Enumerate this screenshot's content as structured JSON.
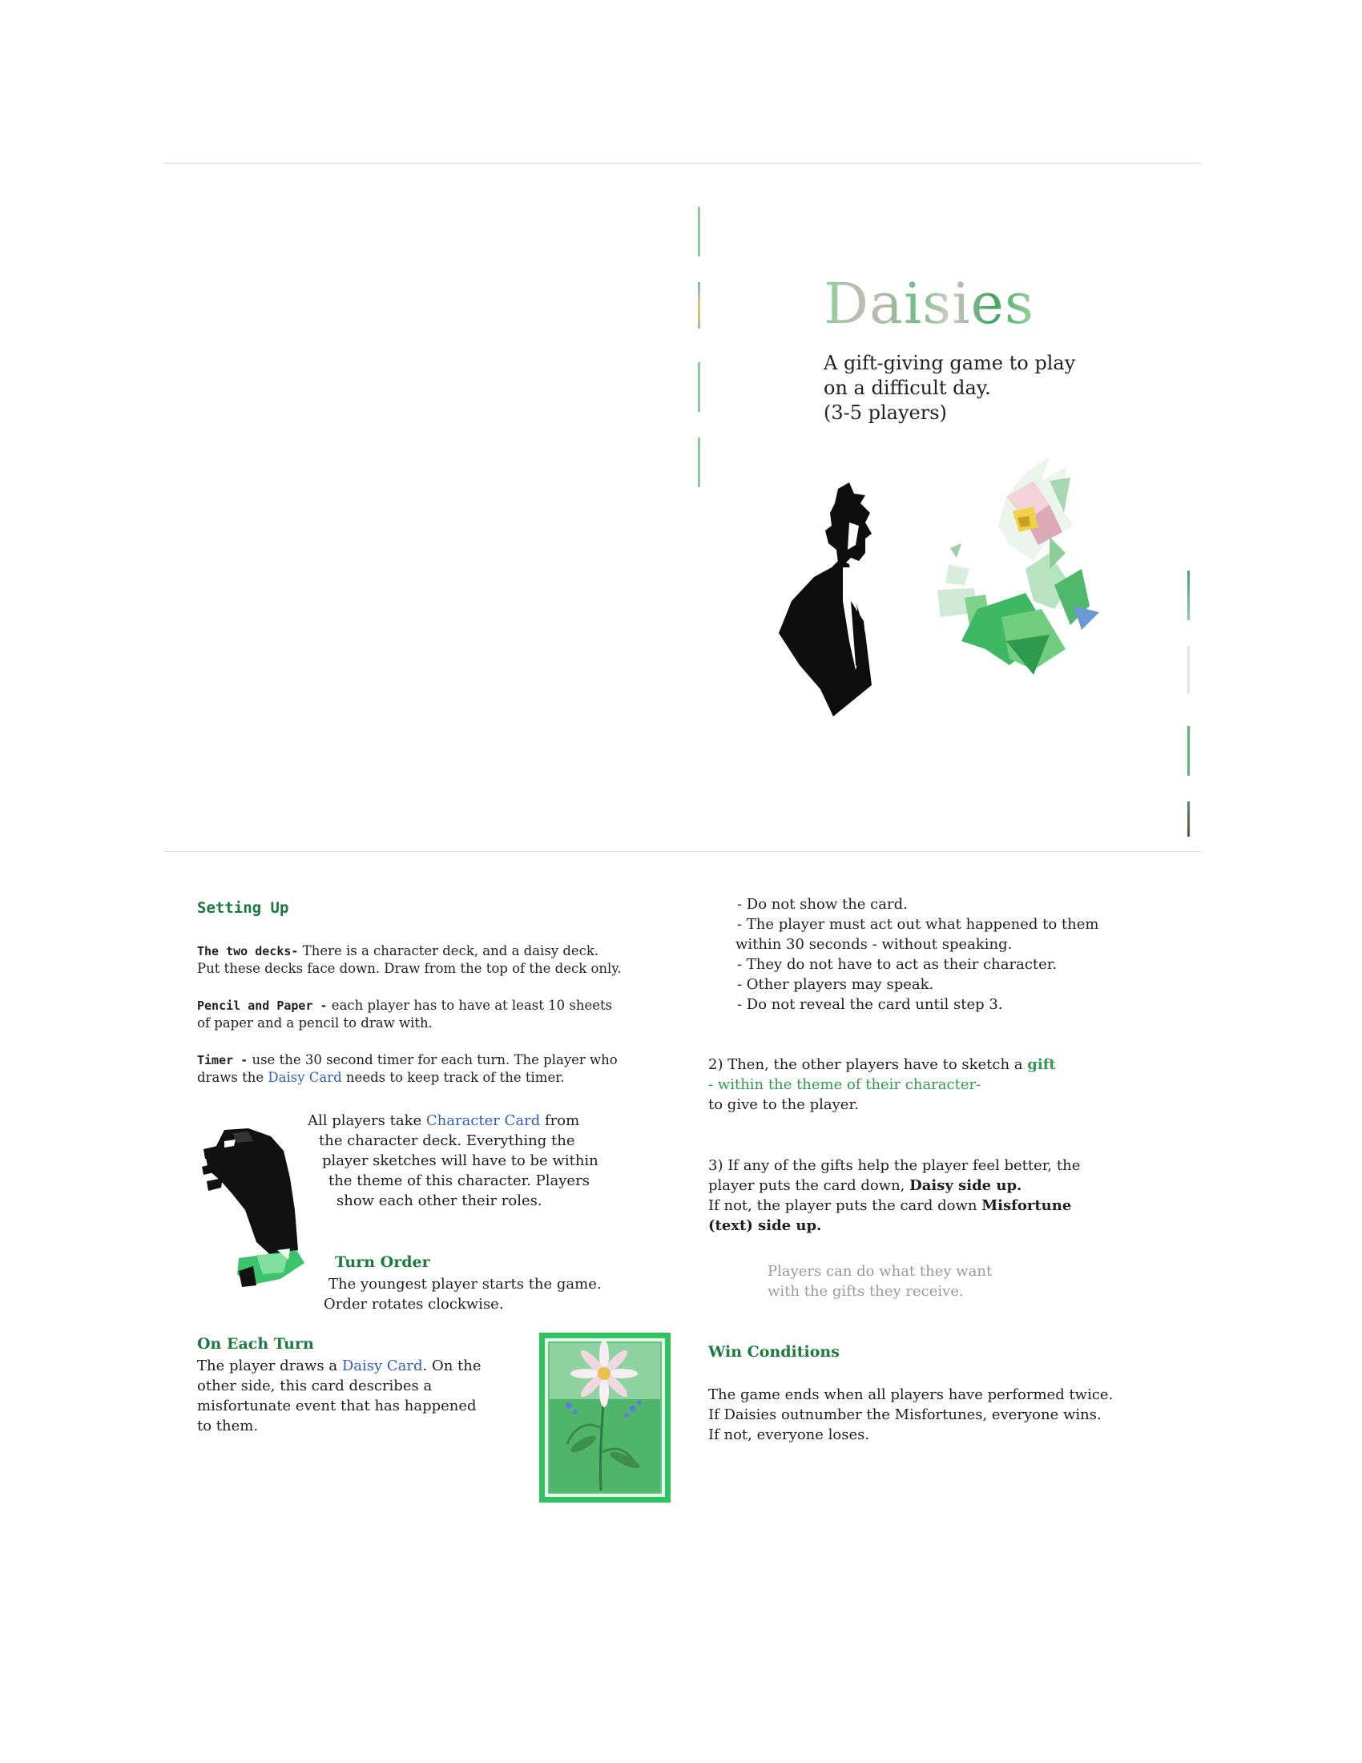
{
  "cover": {
    "title": "Daisies",
    "subtitle_lines": [
      "A gift-giving game to play",
      "on a difficult day.",
      "(3-5 players)"
    ]
  },
  "setup": {
    "heading": "Setting Up",
    "decks_label": "The two decks-",
    "decks_text_1": " There is a character deck, and a daisy deck.",
    "decks_text_2": "Put these decks face down. Draw from the top of the deck only.",
    "pencil_label": "Pencil and Paper -",
    "pencil_text_1": " each player has to have at least 10 sheets",
    "pencil_text_2": "of paper and a pencil to draw with.",
    "timer_label": "Timer -",
    "timer_text_1": " use the 30 second timer for each turn. The player who",
    "timer_text_2a": "draws the ",
    "timer_link": "Daisy Card",
    "timer_text_2b": " needs to keep track of the timer."
  },
  "character": {
    "line1a": "All players take ",
    "line1_link": "Character Card",
    "line1b": " from",
    "line2": "the character deck. Everything the",
    "line3": "player sketches will have to be within",
    "line4": "the theme of this character. Players",
    "line5": "show each other their roles."
  },
  "turn_order": {
    "heading": "Turn Order",
    "line1": "The youngest player starts the game.",
    "line2": "Order rotates clockwise."
  },
  "each_turn": {
    "heading": "On Each Turn",
    "line1a": "The player draws a ",
    "line1_link": "Daisy Card",
    "line1b": ". On the",
    "line2": "other side, this card describes a",
    "line3": "misfortunate event that has happened",
    "line4": "to them."
  },
  "rules_top": [
    "- Do not show the card.",
    "- The player must act out what happened to them",
    "within 30 seconds - without speaking.",
    "- They do not have to act as their character.",
    "- Other players may speak.",
    "- Do not reveal the card until step 3."
  ],
  "step2": {
    "line1a": "2) Then, the other players have to sketch a ",
    "line1_gift": "gift",
    "line2": " - within the theme of their character-",
    "line3": "to give to the player."
  },
  "step3": {
    "line1": "3) If any of the gifts help the player feel better, the",
    "line2a": "player puts the card down, ",
    "line2b": "Daisy side up.",
    "line3a": "If not, the player puts the card down ",
    "line3b": "Misfortune",
    "line4": "(text) side up."
  },
  "note": {
    "line1": "Players can do what they want",
    "line2": "with the gifts they receive."
  },
  "win": {
    "heading": "Win Conditions",
    "line1": "The game ends when all players have performed twice.",
    "line2": "If Daisies outnumber the Misfortunes, everyone wins.",
    "line3": "If not, everyone loses."
  },
  "colors": {
    "heading_green": "#1b7a3c",
    "link_blue": "#2e5fb8",
    "accent_green": "#2f9a52",
    "rule_green": "#bfeccb"
  },
  "icons": [
    "silhouette-figure",
    "crystal-flower-gift",
    "reaching-hand",
    "daisy-card-illustration"
  ]
}
